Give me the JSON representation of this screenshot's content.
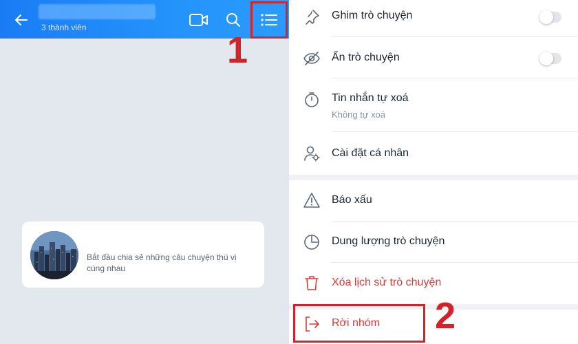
{
  "chat": {
    "header": {
      "members_text": "3 thành viên"
    },
    "intro": {
      "text": "Bắt đầu chia sẻ những câu chuyện thú vị cùng nhau"
    }
  },
  "menu": {
    "items": [
      {
        "label": "Ghim trò chuyện",
        "icon": "pin-icon"
      },
      {
        "label": "Ẩn trò chuyện",
        "icon": "eye-off-icon"
      },
      {
        "label": "Tin nhắn tự xoá",
        "sublabel": "Không tự xoá",
        "icon": "timer-icon"
      },
      {
        "label": "Cài đặt cá nhân",
        "icon": "user-settings-icon"
      },
      {
        "label": "Báo xấu",
        "icon": "warning-icon"
      },
      {
        "label": "Dung lượng trò chuyện",
        "icon": "pie-chart-icon"
      },
      {
        "label": "Xóa lịch sử trò chuyện",
        "icon": "trash-icon"
      },
      {
        "label": "Rời nhóm",
        "icon": "leave-icon"
      }
    ],
    "toggles": {
      "pin": false,
      "hide": false
    }
  },
  "annotations": {
    "step1": "1",
    "step2": "2"
  },
  "colors": {
    "header_blue": "#1a7cf5",
    "danger_red": "#dc3a3a",
    "annotation_red": "#d0232a"
  }
}
